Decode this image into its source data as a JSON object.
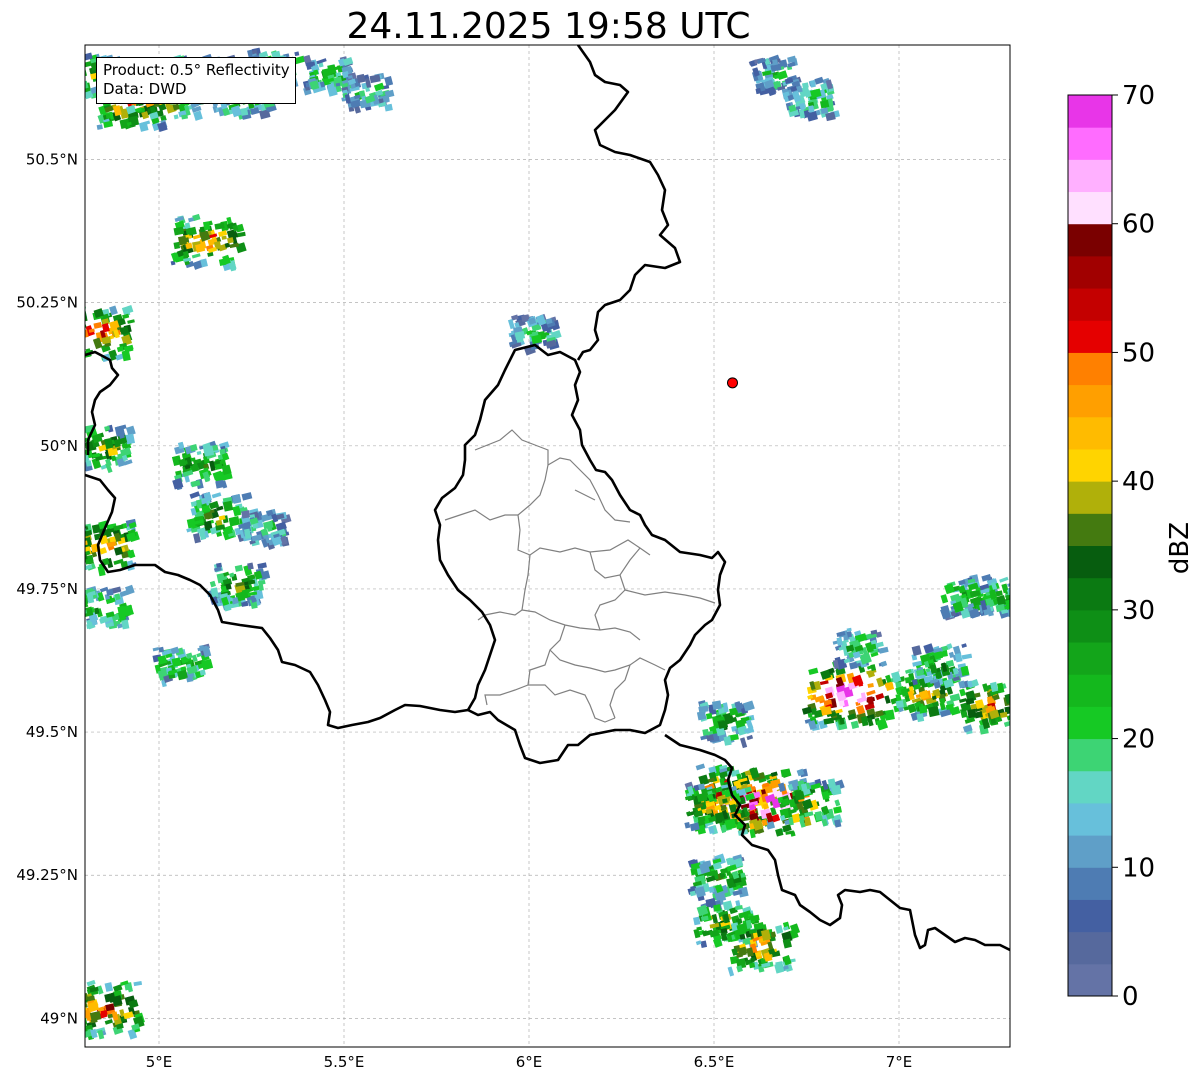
{
  "title": "24.11.2025 19:58 UTC",
  "info_box": {
    "product_line": "Product: 0.5° Reflectivity",
    "data_line": "Data: DWD"
  },
  "map": {
    "lon_range": [
      4.8,
      7.3
    ],
    "lat_range": [
      48.95,
      50.7
    ],
    "lon_ticks": [
      {
        "value": 5.0,
        "label": "5°E"
      },
      {
        "value": 5.5,
        "label": "5.5°E"
      },
      {
        "value": 6.0,
        "label": "6°E"
      },
      {
        "value": 6.5,
        "label": "6.5°E"
      },
      {
        "value": 7.0,
        "label": "7°E"
      }
    ],
    "lat_ticks": [
      {
        "value": 49.0,
        "label": "49°N"
      },
      {
        "value": 49.25,
        "label": "49.25°N"
      },
      {
        "value": 49.5,
        "label": "49.5°N"
      },
      {
        "value": 49.75,
        "label": "49.75°N"
      },
      {
        "value": 50.0,
        "label": "50°N"
      },
      {
        "value": 50.25,
        "label": "50.25°N"
      },
      {
        "value": 50.5,
        "label": "50.5°N"
      }
    ],
    "grid": true,
    "marker": {
      "lon": 6.55,
      "lat": 50.11,
      "color": "#ff0000"
    }
  },
  "colorbar": {
    "label": "dBZ",
    "min": 0,
    "max": 70,
    "step": 2.5,
    "ticks": [
      {
        "value": 0,
        "label": "0"
      },
      {
        "value": 10,
        "label": "10"
      },
      {
        "value": 20,
        "label": "20"
      },
      {
        "value": 30,
        "label": "30"
      },
      {
        "value": 40,
        "label": "40"
      },
      {
        "value": 50,
        "label": "50"
      },
      {
        "value": 60,
        "label": "60"
      },
      {
        "value": 70,
        "label": "70"
      }
    ],
    "colors": [
      "#6473a6",
      "#56699d",
      "#4460a2",
      "#4e7cb3",
      "#5f9fc8",
      "#67c0db",
      "#62d6c4",
      "#3dd474",
      "#16c924",
      "#14b81d",
      "#13a51a",
      "#0e8f16",
      "#0b7a12",
      "#075d0f",
      "#447a10",
      "#b0b00a",
      "#ffd400",
      "#ffbb00",
      "#ff9f00",
      "#ff8000",
      "#e50000",
      "#c40000",
      "#a10000",
      "#7a0000",
      "#ffe0ff",
      "#ffb0ff",
      "#ff6cff",
      "#e835e8"
    ]
  },
  "radar_cells": [
    {
      "lon": 4.82,
      "lat": 50.65,
      "level": 14
    },
    {
      "lon": 4.92,
      "lat": 50.6,
      "level": 20
    },
    {
      "lon": 5.0,
      "lat": 50.62,
      "level": 22
    },
    {
      "lon": 5.1,
      "lat": 50.64,
      "level": 18
    },
    {
      "lon": 5.22,
      "lat": 50.62,
      "level": 15
    },
    {
      "lon": 5.3,
      "lat": 50.66,
      "level": 12
    },
    {
      "lon": 5.45,
      "lat": 50.65,
      "level": 10
    },
    {
      "lon": 5.55,
      "lat": 50.62,
      "level": 8
    },
    {
      "lon": 5.12,
      "lat": 50.36,
      "level": 20
    },
    {
      "lon": 4.83,
      "lat": 50.2,
      "level": 22
    },
    {
      "lon": 4.84,
      "lat": 50.0,
      "level": 15
    },
    {
      "lon": 4.84,
      "lat": 49.83,
      "level": 20
    },
    {
      "lon": 4.84,
      "lat": 49.72,
      "level": 12
    },
    {
      "lon": 5.1,
      "lat": 49.97,
      "level": 14
    },
    {
      "lon": 5.15,
      "lat": 49.88,
      "level": 15
    },
    {
      "lon": 5.2,
      "lat": 49.76,
      "level": 14
    },
    {
      "lon": 5.27,
      "lat": 49.86,
      "level": 8
    },
    {
      "lon": 5.05,
      "lat": 49.62,
      "level": 11
    },
    {
      "lon": 4.84,
      "lat": 49.02,
      "level": 22
    },
    {
      "lon": 6.55,
      "lat": 49.39,
      "level": 28
    },
    {
      "lon": 6.63,
      "lat": 49.38,
      "level": 32
    },
    {
      "lon": 6.5,
      "lat": 49.37,
      "level": 18
    },
    {
      "lon": 6.75,
      "lat": 49.38,
      "level": 16
    },
    {
      "lon": 6.52,
      "lat": 49.52,
      "level": 12
    },
    {
      "lon": 6.85,
      "lat": 49.57,
      "level": 30
    },
    {
      "lon": 7.06,
      "lat": 49.57,
      "level": 18
    },
    {
      "lon": 7.25,
      "lat": 49.55,
      "level": 20
    },
    {
      "lon": 7.1,
      "lat": 49.62,
      "level": 12
    },
    {
      "lon": 6.88,
      "lat": 49.65,
      "level": 10
    },
    {
      "lon": 6.5,
      "lat": 49.25,
      "level": 13
    },
    {
      "lon": 6.52,
      "lat": 49.17,
      "level": 16
    },
    {
      "lon": 6.62,
      "lat": 49.13,
      "level": 20
    },
    {
      "lon": 6.0,
      "lat": 50.2,
      "level": 8
    },
    {
      "lon": 6.65,
      "lat": 50.65,
      "level": 8
    },
    {
      "lon": 6.75,
      "lat": 50.61,
      "level": 10
    },
    {
      "lon": 7.18,
      "lat": 49.74,
      "level": 12
    },
    {
      "lon": 7.28,
      "lat": 49.74,
      "level": 10
    }
  ]
}
